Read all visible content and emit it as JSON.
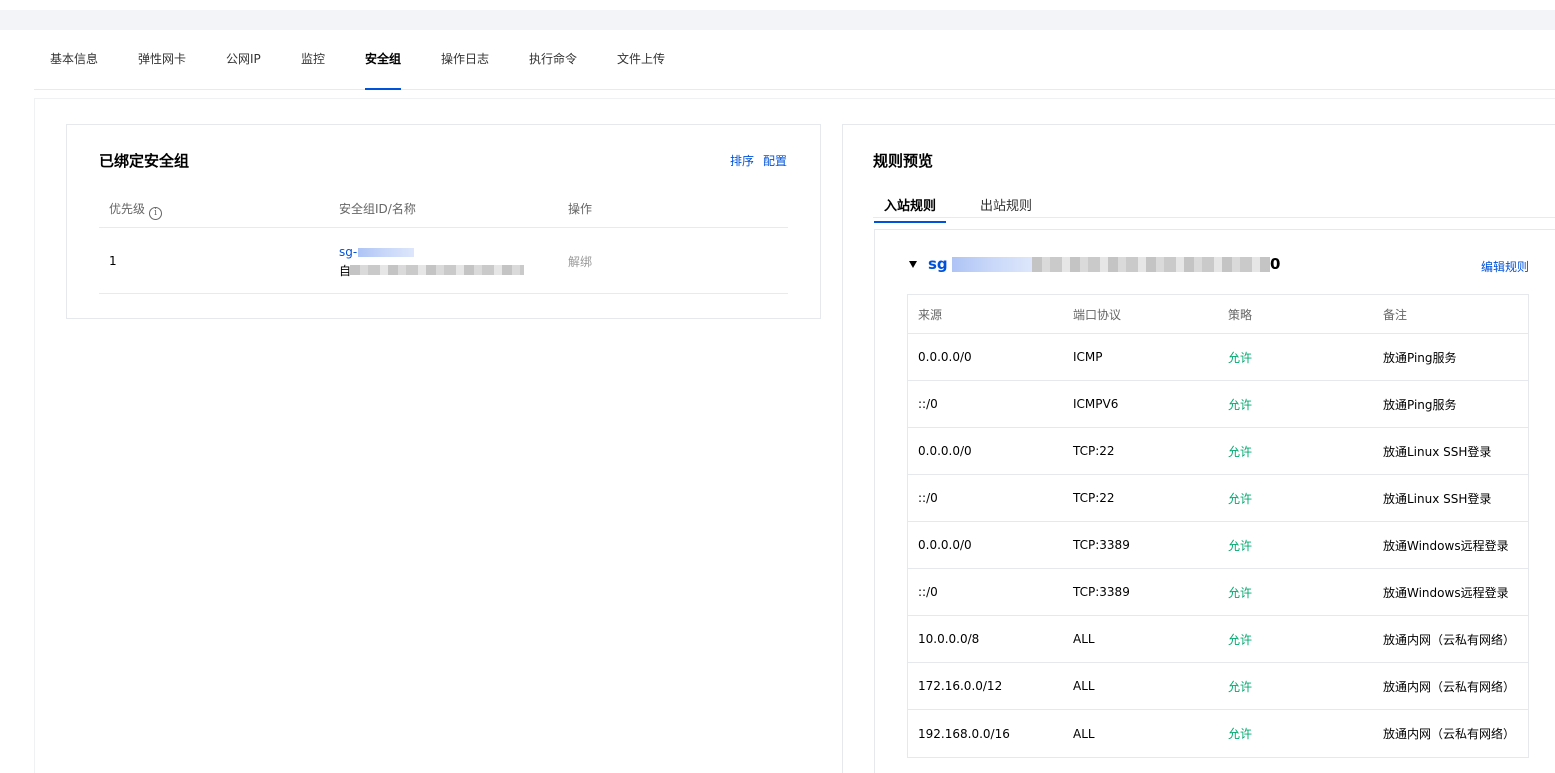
{
  "tabs": [
    {
      "label": "基本信息",
      "active": false
    },
    {
      "label": "弹性网卡",
      "active": false
    },
    {
      "label": "公网IP",
      "active": false
    },
    {
      "label": "监控",
      "active": false
    },
    {
      "label": "安全组",
      "active": true
    },
    {
      "label": "操作日志",
      "active": false
    },
    {
      "label": "执行命令",
      "active": false
    },
    {
      "label": "文件上传",
      "active": false
    }
  ],
  "bound": {
    "title": "已绑定安全组",
    "sort_label": "排序",
    "config_label": "配置",
    "columns": {
      "priority": "优先级",
      "info_glyph": "i",
      "sg": "安全组ID/名称",
      "action": "操作"
    },
    "row": {
      "priority": "1",
      "sg_id_prefix": "sg-",
      "name_prefix": "自",
      "unbind": "解绑"
    }
  },
  "preview": {
    "title": "规则预览",
    "inbound_label": "入站规则",
    "outbound_label": "出站规则",
    "sg_prefix": "sg",
    "sg_suffix": "0",
    "edit_label": "编辑规则",
    "columns": {
      "source": "来源",
      "port": "端口协议",
      "policy": "策略",
      "remark": "备注"
    },
    "rules": [
      {
        "source": "0.0.0.0/0",
        "port": "ICMP",
        "policy": "允许",
        "remark": "放通Ping服务"
      },
      {
        "source": "::/0",
        "port": "ICMPV6",
        "policy": "允许",
        "remark": "放通Ping服务"
      },
      {
        "source": "0.0.0.0/0",
        "port": "TCP:22",
        "policy": "允许",
        "remark": "放通Linux SSH登录"
      },
      {
        "source": "::/0",
        "port": "TCP:22",
        "policy": "允许",
        "remark": "放通Linux SSH登录"
      },
      {
        "source": "0.0.0.0/0",
        "port": "TCP:3389",
        "policy": "允许",
        "remark": "放通Windows远程登录"
      },
      {
        "source": "::/0",
        "port": "TCP:3389",
        "policy": "允许",
        "remark": "放通Windows远程登录"
      },
      {
        "source": "10.0.0.0/8",
        "port": "ALL",
        "policy": "允许",
        "remark": "放通内网（云私有网络）"
      },
      {
        "source": "172.16.0.0/12",
        "port": "ALL",
        "policy": "允许",
        "remark": "放通内网（云私有网络）"
      },
      {
        "source": "192.168.0.0/16",
        "port": "ALL",
        "policy": "允许",
        "remark": "放通内网（云私有网络）"
      }
    ]
  },
  "colors": {
    "accent": "#0052d9",
    "allow": "#00a870"
  }
}
